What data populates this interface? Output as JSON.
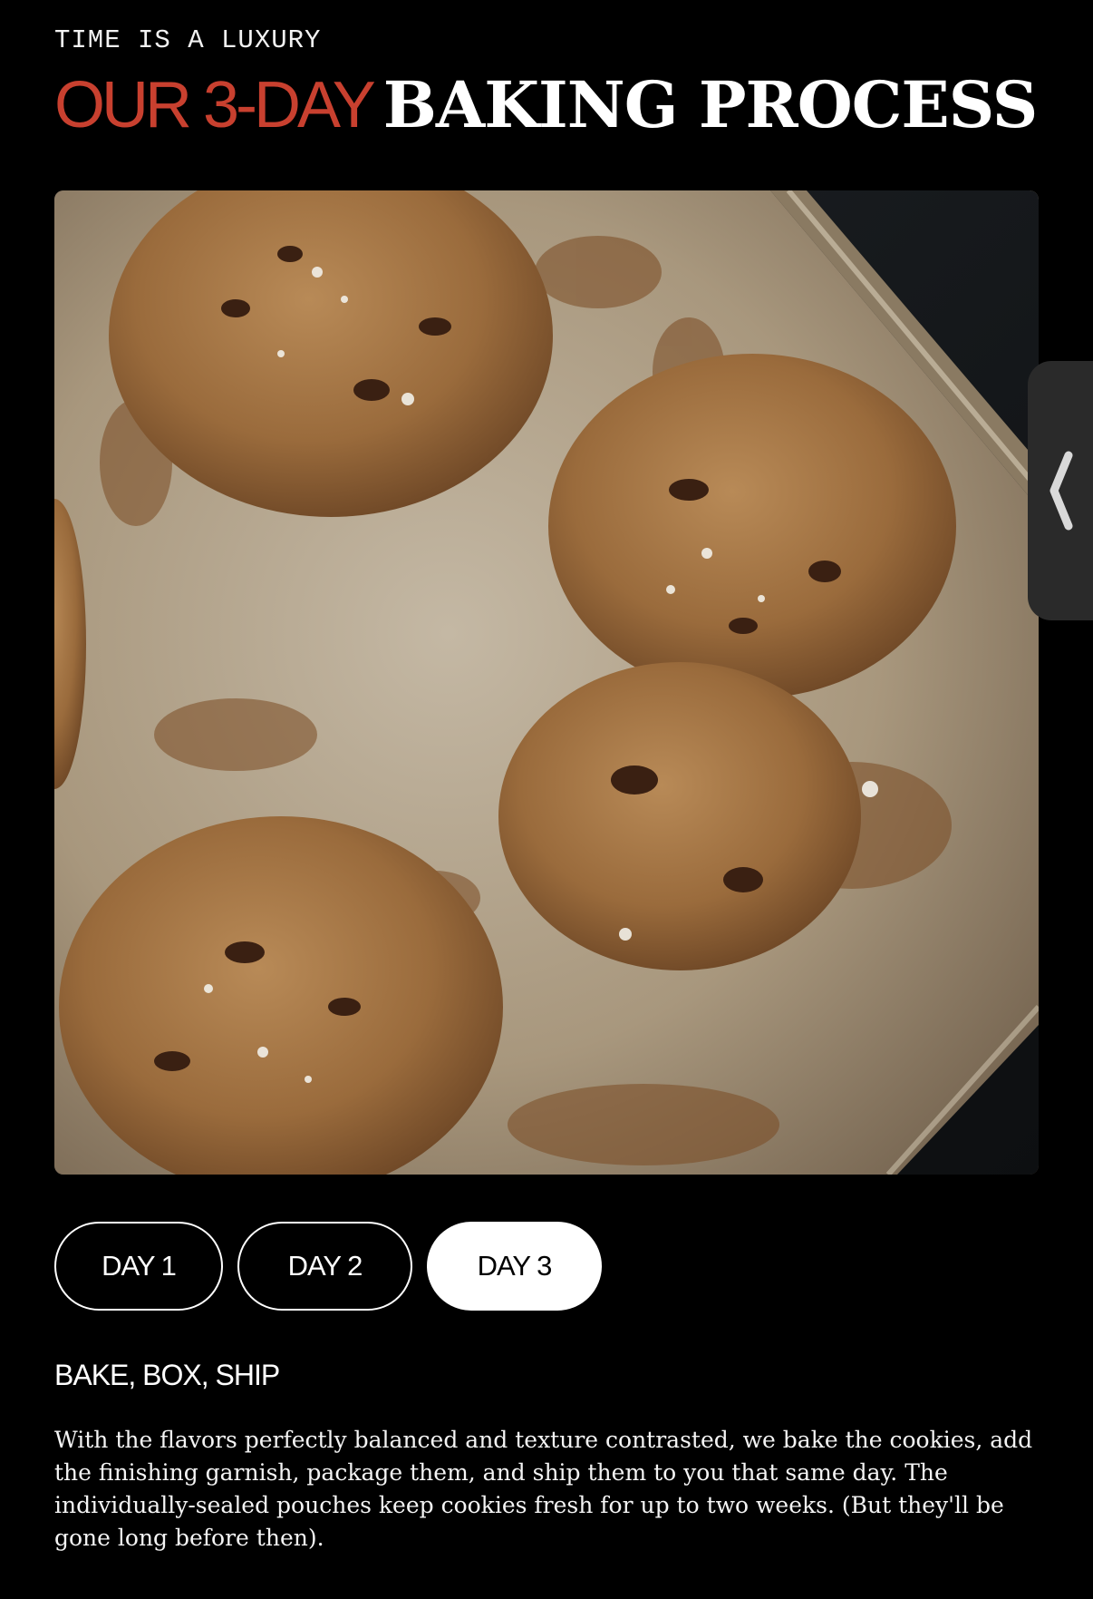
{
  "header": {
    "eyebrow": "TIME IS A LUXURY",
    "headline_accent": "OUR 3-DAY",
    "headline_rest": "BAKING PROCESS"
  },
  "hero_image": {
    "alt": "Chocolate chip cookies on a baking sheet"
  },
  "side_tab": {
    "icon": "chevron-left-icon"
  },
  "day_tabs": [
    {
      "label": "DAY 1",
      "selected": false
    },
    {
      "label": "DAY 2",
      "selected": false
    },
    {
      "label": "DAY 3",
      "selected": true
    }
  ],
  "step": {
    "title": "BAKE, BOX, SHIP",
    "body": "With the flavors perfectly balanced and texture contrasted, we bake the cookies, add the finishing garnish, package them, and ship them to you that same day. The individually-sealed pouches keep cookies fresh for up to two weeks. (But they'll be gone long before then)."
  },
  "colors": {
    "background": "#000000",
    "accent": "#c8402f",
    "text": "#ffffff",
    "tab_selected_bg": "#ffffff",
    "side_tab_bg": "#2a2a2a"
  }
}
